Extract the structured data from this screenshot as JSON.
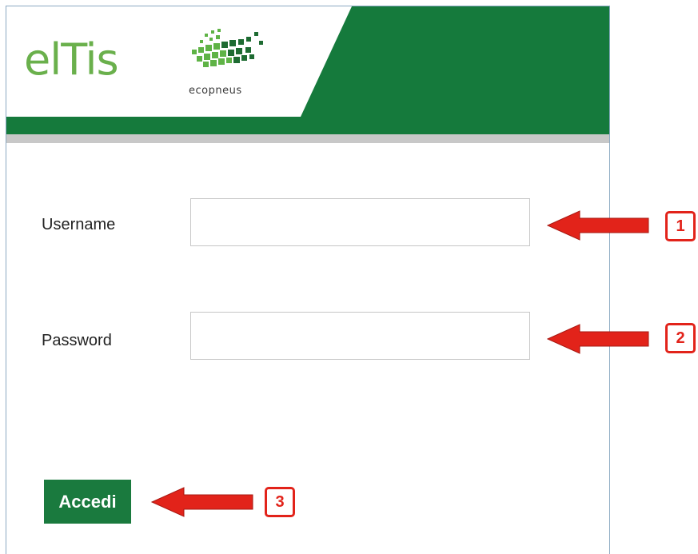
{
  "header": {
    "logo_text": "elTis",
    "sublogo_text": "ecopneus"
  },
  "form": {
    "username_label": "Username",
    "username_value": "",
    "password_label": "Password",
    "password_value": "",
    "submit_label": "Accedi"
  },
  "annotations": [
    {
      "number": "1"
    },
    {
      "number": "2"
    },
    {
      "number": "3"
    }
  ],
  "colors": {
    "brand_green": "#1a7a3e",
    "logo_green": "#6ab04c",
    "annotation_red": "#e2231a"
  },
  "icons": {
    "logo_mark": "ecopneus-dots-logo-icon",
    "arrow": "red-left-arrow-icon"
  }
}
